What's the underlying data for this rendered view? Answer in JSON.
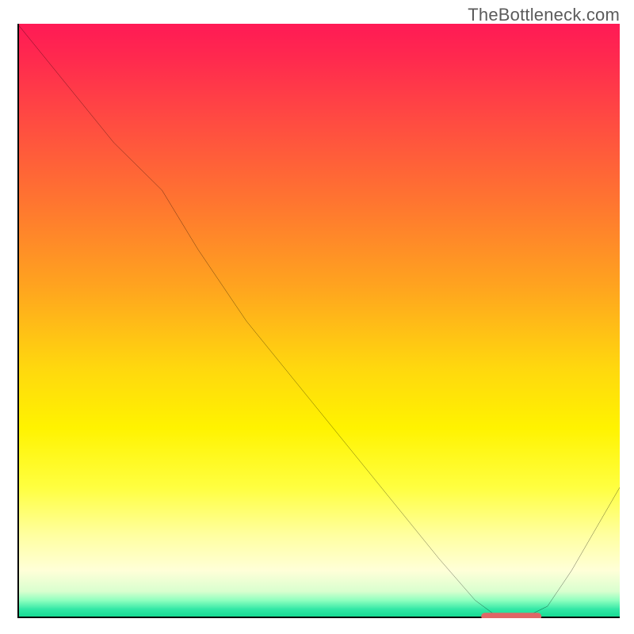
{
  "attribution": "TheBottleneck.com",
  "colors": {
    "curve": "#000000",
    "highlight": "#e06666"
  },
  "chart_data": {
    "type": "line",
    "title": "",
    "xlabel": "",
    "ylabel": "",
    "xlim": [
      0,
      100
    ],
    "ylim": [
      0,
      100
    ],
    "x": [
      0,
      8,
      16,
      24,
      30,
      38,
      46,
      54,
      62,
      70,
      76,
      80,
      84,
      88,
      92,
      100
    ],
    "values": [
      100,
      90,
      80,
      72,
      62,
      50,
      40,
      30,
      20,
      10,
      3,
      0,
      0,
      2,
      8,
      22
    ],
    "highlight_range": [
      77,
      87
    ],
    "highlight_y": 0
  }
}
